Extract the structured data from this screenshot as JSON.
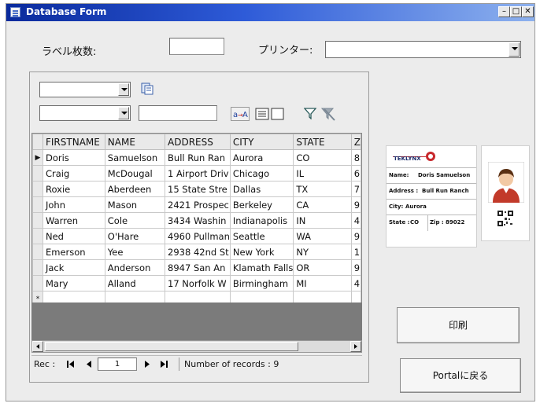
{
  "window": {
    "title": "Database Form"
  },
  "colors": {
    "titlebar": "#0a2a9c",
    "accent_red": "#c8282c",
    "grid_gray": "#7b7b7b"
  },
  "form": {
    "label_count_label": "ラベル枚数:",
    "label_count_value": "",
    "printer_label": "プリンター:",
    "printer_value": ""
  },
  "filter": {
    "field_combo_value": "",
    "operator_combo_value": "",
    "filter_text_value": "",
    "icons": [
      "database-query-icon",
      "find-replace-icon",
      "list-view-icon",
      "filter-icon",
      "remove-filter-icon"
    ]
  },
  "grid": {
    "columns": [
      "FIRSTNAME",
      "NAME",
      "ADDRESS",
      "CITY",
      "STATE",
      "Z"
    ],
    "rows": [
      [
        "Doris",
        "Samuelson",
        "Bull Run Ran",
        "Aurora",
        "CO",
        "8"
      ],
      [
        "Craig",
        "McDougal",
        "1 Airport Driv",
        "Chicago",
        "IL",
        "6"
      ],
      [
        "Roxie",
        "Aberdeen",
        "15 State Stre",
        "Dallas",
        "TX",
        "7"
      ],
      [
        "John",
        "Mason",
        "2421 Prospec",
        "Berkeley",
        "CA",
        "9"
      ],
      [
        "Warren",
        "Cole",
        "3434 Washin",
        "Indianapolis",
        "IN",
        "4"
      ],
      [
        "Ned",
        "O'Hare",
        "4960 Pullman",
        "Seattle",
        "WA",
        "9"
      ],
      [
        "Emerson",
        "Yee",
        "2938 42nd St",
        "New York",
        "NY",
        "1"
      ],
      [
        "Jack",
        "Anderson",
        "8947 San An",
        "Klamath Falls",
        "OR",
        "9"
      ],
      [
        "Mary",
        "Alland",
        "17 Norfolk W",
        "Birmingham",
        "MI",
        "4"
      ]
    ],
    "current_row_marker": "▶",
    "new_row_marker": "*"
  },
  "navigator": {
    "record_label": "Rec :",
    "current_record": "1",
    "record_count_text": "Number of records : 9"
  },
  "buttons": {
    "print_label": "印刷",
    "portal_label": "Portalに戻る"
  },
  "preview": {
    "logo_text": "TEKLYNX",
    "name_label": "Name:",
    "name_value": "Doris Samuelson",
    "address_label": "Address :",
    "address_value": "Bull Run Ranch",
    "city_label": "City:",
    "city_value": "Aurora",
    "state_label": "State :",
    "state_value": "CO",
    "zip_label": "Zip :",
    "zip_value": "89022"
  }
}
